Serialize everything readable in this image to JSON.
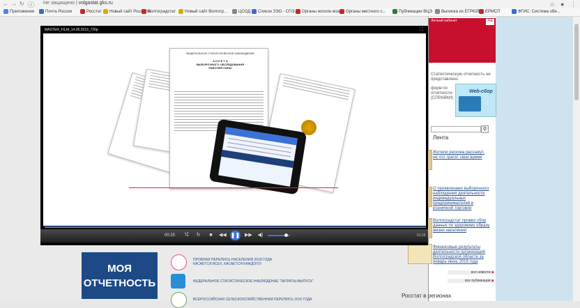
{
  "browser": {
    "security": "Не защищено",
    "url": "volgastat.gks.ru",
    "bookmarks": [
      {
        "label": "Приложения",
        "color": "#4a86e8"
      },
      {
        "label": "Почта России",
        "color": "#3b6ec4"
      },
      {
        "label": "Росстат",
        "color": "#c62828"
      },
      {
        "label": "Новый сайт Росстата",
        "color": "#e0a800"
      },
      {
        "label": "Волгоградстат",
        "color": "#c62828"
      },
      {
        "label": "Новый сайт Волгогр...",
        "color": "#e0a800"
      },
      {
        "label": "ЦСОД",
        "color": "#888"
      },
      {
        "label": "Список ЗЭО - СПЭ...",
        "color": "#3b6ec4"
      },
      {
        "label": "Органы исполн вла...",
        "color": "#c62828"
      },
      {
        "label": "Органы местного с...",
        "color": "#c62828"
      },
      {
        "label": "Публикации ВЦЭ",
        "color": "#2e7d32"
      },
      {
        "label": "Выписка из ЕГРЮЛ",
        "color": "#888"
      },
      {
        "label": "ЕРМСП",
        "color": "#c62828"
      },
      {
        "label": "ФГИС: Система обе...",
        "color": "#3b6ec4"
      }
    ]
  },
  "video": {
    "title": "MASTER_FILM_14.05.2019_720p",
    "elapsed": "00:25",
    "duration": "01:15",
    "doc_title_lines": [
      "ФЕДЕРАЛЬНОЕ СТАТИСТИЧЕСКОЕ НАБЛЮДЕНИЕ",
      "А Н К Е Т А",
      "ВЫБОРОЧНОГО ОБСЛЕДОВАНИЯ",
      "РАБОЧЕЙ СИЛЫ"
    ]
  },
  "site": {
    "cabinet": "Личный кабинет",
    "report_text": "Статистическую отчетность не представлено",
    "forms_text": "форм по отчетности (СПРАВКИ)",
    "webcor": "Web-сбор",
    "lenta": "Лента",
    "news": [
      "Жители региона рассажут, не что тратят свои время",
      "О проявлениии выборочного наблюдения деятельности индивидуальных предпринимателей в розничной торговле",
      "Волгоградстат провел сбор данных по здоровому образу жизни населения",
      "Финансовые результаты деятельности организаций Волгоградской области за январь-июнь 2019 года"
    ],
    "all_news": "все новости",
    "all_pubs": "все публикации",
    "regions": "Росстат в регионах",
    "moya": [
      "МОЯ",
      "ОТЧЕТНОСТЬ"
    ],
    "census": [
      {
        "l1": "ПРОБНАЯ ПЕРЕПИСЬ НАСЕЛЕНИЯ 2018 ГОДА",
        "l2": "КАСАЕТСЯ ВСЕХ, КАСАЕТСЯ КАЖДОГО!"
      },
      {
        "l1": "ФЕДЕРАЛЬНОЕ СТАТИСТИЧЕСКОЕ НАБЛЮДЕНИЕ \"ЗАТРАТЫ-ВЫПУСК\"",
        "l2": ""
      },
      {
        "l1": "ВСЕРОССИЙСКАЯ СЕЛЬСКОХОЗЯЙСТВЕННАЯ ПЕРЕПИСЬ 2016 ГОДА",
        "l2": ""
      }
    ]
  }
}
